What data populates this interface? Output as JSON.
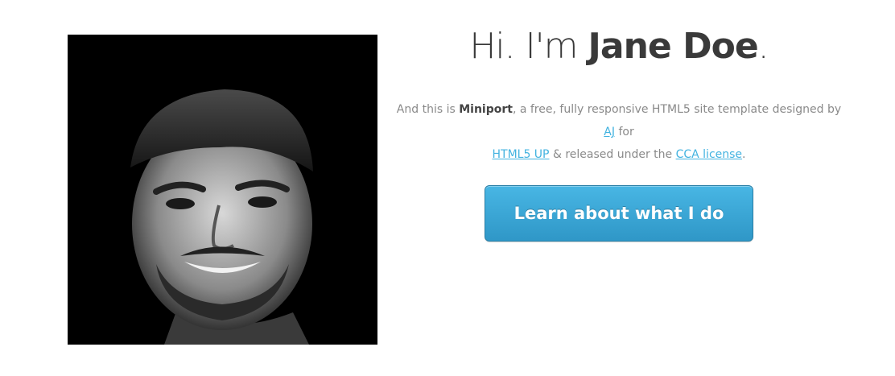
{
  "headline": {
    "greeting": "Hi. I'm ",
    "name": "Jane Doe",
    "end": "."
  },
  "blurb": {
    "part1": "And this is ",
    "product": "Miniport",
    "part2": ", a free, fully responsive HTML5 site template designed by ",
    "author_link": "AJ",
    "part3": " for ",
    "html5up_link": "HTML5 UP",
    "part4": " & released under the ",
    "license_link": "CCA license",
    "part5": "."
  },
  "cta": {
    "label": "Learn about what I do"
  },
  "colors": {
    "link": "#43b3e0",
    "button": "#3aa6d6",
    "text": "#3a3a3a"
  }
}
